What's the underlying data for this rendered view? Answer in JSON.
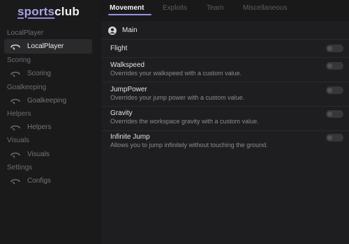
{
  "brand": {
    "name_part1": "sports",
    "name_part2": "club",
    "accent_color": "#a8a4e6"
  },
  "sidebar": {
    "sections": [
      {
        "heading": "LocalPlayer",
        "item": {
          "label": "LocalPlayer",
          "icon": "steering-icon",
          "active": true
        }
      },
      {
        "heading": "Scoring",
        "item": {
          "label": "Scoring",
          "icon": "steering-icon",
          "active": false
        }
      },
      {
        "heading": "Goalkeeping",
        "item": {
          "label": "Goalkeeping",
          "icon": "steering-icon",
          "active": false
        }
      },
      {
        "heading": "Helpers",
        "item": {
          "label": "Helpers",
          "icon": "steering-icon",
          "active": false
        }
      },
      {
        "heading": "Visuals",
        "item": {
          "label": "Visuals",
          "icon": "steering-icon",
          "active": false
        }
      },
      {
        "heading": "Settings",
        "item": {
          "label": "Configs",
          "icon": "steering-icon",
          "active": false
        }
      }
    ]
  },
  "tabs": [
    {
      "label": "Movement",
      "active": true
    },
    {
      "label": "Exploits",
      "active": false
    },
    {
      "label": "Team",
      "active": false
    },
    {
      "label": "Miscellaneous",
      "active": false
    }
  ],
  "panel": {
    "title": "Main",
    "icon": "user-icon",
    "settings": [
      {
        "title": "Flight",
        "description": "",
        "enabled": false
      },
      {
        "title": "Walkspeed",
        "description": "Overrides your walkspeed with a custom value.",
        "enabled": false
      },
      {
        "title": "JumpPower",
        "description": "Overrides your jump power with a custom value.",
        "enabled": false
      },
      {
        "title": "Gravity",
        "description": "Overrides the workspace gravity with a custom value.",
        "enabled": false
      },
      {
        "title": "Infinite Jump",
        "description": "Allows you to jump infinitely without touching the ground.",
        "enabled": false
      }
    ]
  }
}
